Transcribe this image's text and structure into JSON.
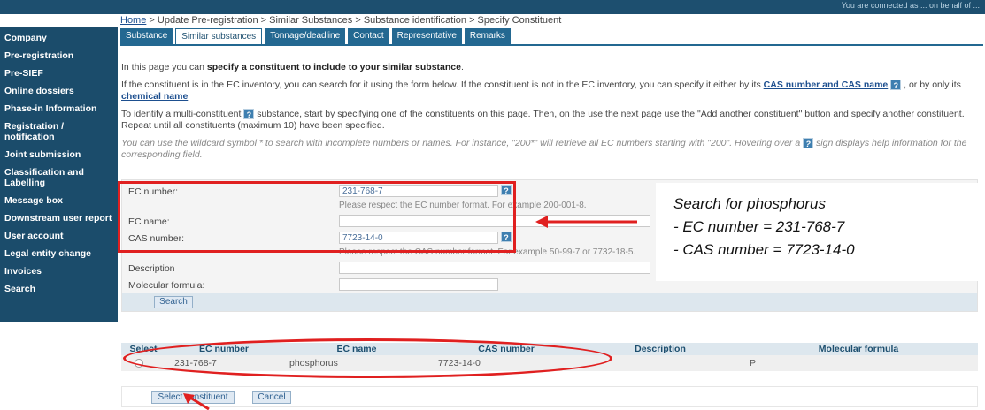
{
  "top_notice": "You are connected as ... on behalf of ...",
  "breadcrumb": {
    "home": "Home",
    "rest": " > Update Pre-registration > Similar Substances > Substance identification > Specify Constituent"
  },
  "sidebar": {
    "items": [
      {
        "label": "Company"
      },
      {
        "label": "Pre-registration"
      },
      {
        "label": "Pre-SIEF"
      },
      {
        "label": "Online dossiers"
      },
      {
        "label": "Phase-in Information"
      },
      {
        "label": "Registration / notification"
      },
      {
        "label": "Joint submission"
      },
      {
        "label": "Classification and Labelling"
      },
      {
        "label": "Message box"
      },
      {
        "label": "Downstream user report"
      },
      {
        "label": "User account"
      },
      {
        "label": "Legal entity change"
      },
      {
        "label": "Invoices"
      },
      {
        "label": "Search"
      }
    ]
  },
  "tabs": [
    {
      "label": "Substance"
    },
    {
      "label": "Similar substances"
    },
    {
      "label": "Tonnage/deadline"
    },
    {
      "label": "Contact"
    },
    {
      "label": "Representative"
    },
    {
      "label": "Remarks"
    }
  ],
  "intro": {
    "p1_prefix": "In this page you can ",
    "p1_bold": "specify a constituent to include to your similar substance",
    "p1_suffix": ".",
    "p2_prefix": "If the constituent is in the EC inventory, you can search for it using the form below. If the constituent is not in the EC inventory, you can specify it either by its ",
    "p2_link1": "CAS number and CAS name",
    "p2_middle": " , or by only its ",
    "p2_link2": "chemical name",
    "p3_prefix": "To identify a multi-constituent ",
    "p3_suffix": " substance, start by specifying one of the constituents on this page. Then, on the use the next page use the \"Add another constituent\" button and specify another constituent. Repeat until all constituents (maximum 10) have been specified.",
    "p4_prefix": "You can use the wildcard symbol * to search with incomplete numbers or names. For instance, \"200*\" will retrieve all EC numbers starting with \"200\". Hovering over a ",
    "p4_suffix": " sign displays help information for the corresponding field.",
    "qmark": "?"
  },
  "form": {
    "ec_number_label": "EC number:",
    "ec_number_value": "231-768-7",
    "ec_number_help": "Please respect the EC number format. For example 200-001-8.",
    "ec_name_label": "EC name:",
    "ec_name_value": "",
    "cas_number_label": "CAS number:",
    "cas_number_value": "7723-14-0",
    "cas_number_help": "Please respect the CAS number format. For example 50-99-7 or 7732-18-5.",
    "description_label": "Description",
    "description_value": "",
    "molecular_formula_label": "Molecular formula:",
    "molecular_formula_value": "",
    "search_button": "Search"
  },
  "callout": {
    "line1": "Search for phosphorus",
    "line2": "- EC number = 231-768-7",
    "line3": "- CAS number = 7723-14-0"
  },
  "results": {
    "headers": [
      "Select",
      "EC number",
      "EC name",
      "CAS number",
      "Description",
      "Molecular formula"
    ],
    "rows": [
      {
        "ec_number": "231-768-7",
        "ec_name": "phosphorus",
        "cas_number": "7723-14-0",
        "description": "",
        "molecular_formula": "P"
      }
    ]
  },
  "buttons": {
    "select_constituent": "Select constituent",
    "cancel": "Cancel"
  },
  "colors": {
    "nav_bg": "#1b4c6b",
    "tab_bg": "#236891",
    "highlight_red": "#e02020",
    "link_blue": "#1d4f8f"
  }
}
